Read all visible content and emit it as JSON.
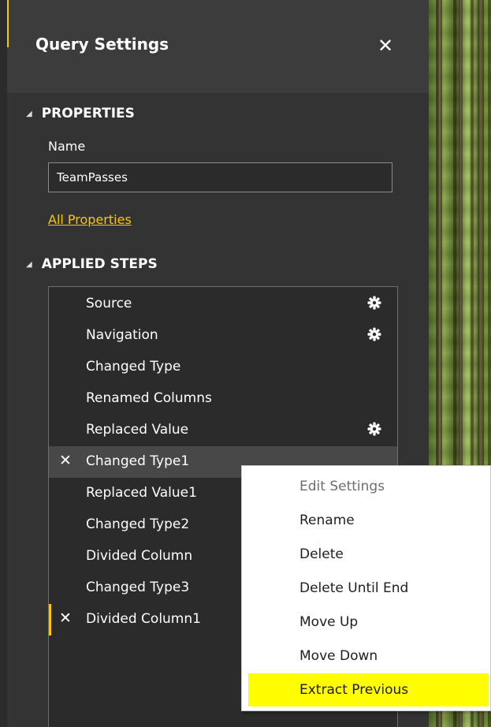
{
  "panel": {
    "title": "Query Settings",
    "close_icon": "close-icon"
  },
  "properties": {
    "heading": "PROPERTIES",
    "name_label": "Name",
    "name_value": "TeamPasses",
    "all_properties_link": "All Properties"
  },
  "applied_steps": {
    "heading": "APPLIED STEPS",
    "items": [
      {
        "label": "Source",
        "gear": true
      },
      {
        "label": "Navigation",
        "gear": true
      },
      {
        "label": "Changed Type",
        "gear": false
      },
      {
        "label": "Renamed Columns",
        "gear": false
      },
      {
        "label": "Replaced Value",
        "gear": true
      },
      {
        "label": "Changed Type1",
        "gear": false,
        "state": "hover"
      },
      {
        "label": "Replaced Value1",
        "gear": false
      },
      {
        "label": "Changed Type2",
        "gear": false
      },
      {
        "label": "Divided Column",
        "gear": false
      },
      {
        "label": "Changed Type3",
        "gear": false
      },
      {
        "label": "Divided Column1",
        "gear": false,
        "state": "selected"
      }
    ]
  },
  "context_menu": {
    "items": [
      {
        "label": "Edit Settings",
        "disabled": true
      },
      {
        "label": "Rename"
      },
      {
        "label": "Delete"
      },
      {
        "label": "Delete Until End"
      },
      {
        "label": "Move Up"
      },
      {
        "label": "Move Down"
      },
      {
        "label": "Extract Previous",
        "highlighted": true
      }
    ]
  },
  "colors": {
    "accent": "#f2c811",
    "menu_highlight": "#fffd00",
    "panel_bg": "#333333"
  }
}
